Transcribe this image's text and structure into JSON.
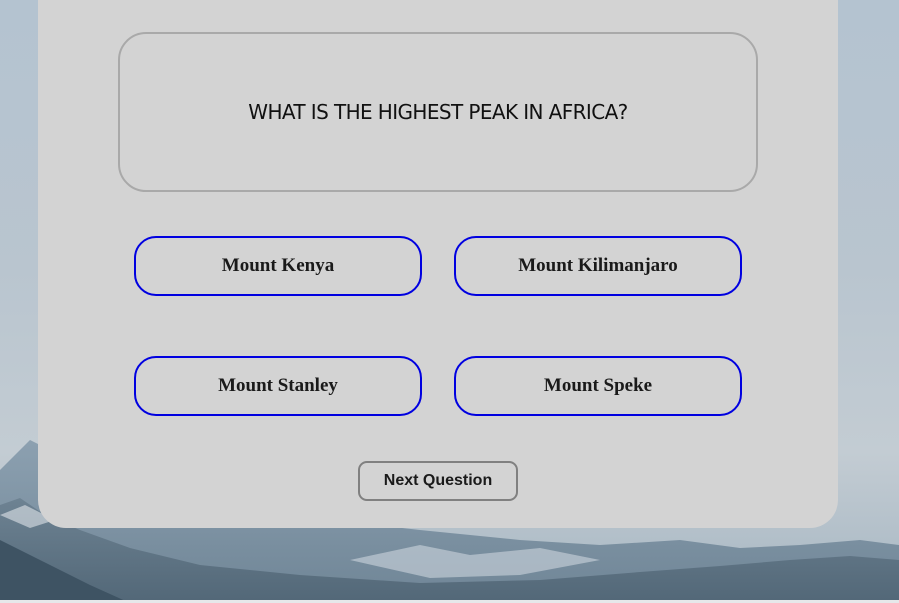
{
  "quiz": {
    "question": "WHAT IS THE HIGHEST PEAK IN AFRICA?",
    "answers": [
      {
        "label": "Mount Kenya"
      },
      {
        "label": "Mount Kilimanjaro"
      },
      {
        "label": "Mount Stanley"
      },
      {
        "label": "Mount Speke"
      }
    ],
    "next_label": "Next Question"
  },
  "colors": {
    "card_background": "#d3d3d3",
    "answer_border": "#0000e0",
    "question_border": "#a9a9a9",
    "next_border": "#808080"
  }
}
